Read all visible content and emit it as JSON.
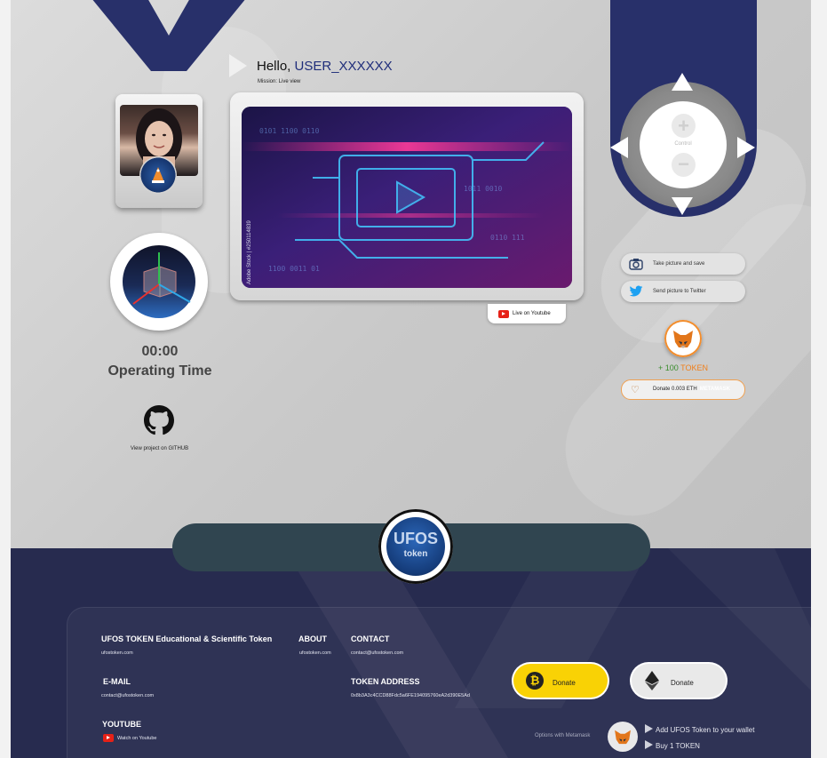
{
  "header": {
    "greeting": "Hello,",
    "username": "USER_XXXXXX",
    "mission": "Mission: Live view"
  },
  "left": {
    "timer_value": "00:00",
    "timer_label": "Operating Time",
    "github_label": "View project on GITHUB"
  },
  "monitor": {
    "watermark": "Adobe Stock | #250114839",
    "live_button": "Live on Youtube"
  },
  "controls": {
    "center_label": "Control",
    "plus": "+",
    "minus": "−",
    "picture_button": "Take picture and save",
    "twitter_button": "Send picture to Twitter"
  },
  "reward": {
    "plus": "+",
    "amount": "100",
    "unit": "TOKEN",
    "donate_text": "Donate 0.003 ETH",
    "donate_brand": "METAMASK"
  },
  "footer": {
    "logo_top": "UFOS",
    "logo_bottom": "token",
    "title": "UFOS TOKEN Educational & Scientific Token",
    "site": "ufostoken.com",
    "about_heading": "ABOUT",
    "about_link": "ufostoken.com",
    "contact_heading": "CONTACT",
    "contact_email": "contact@ufostoken.com",
    "email_heading": "E-MAIL",
    "email_value": "contact@ufostoken.com",
    "token_heading": "TOKEN ADDRESS",
    "token_address": "0x8b3A3c4CCD88Fdc5a6FE194095760eA2d390E5Ad",
    "youtube_heading": "YOUTUBE",
    "youtube_link": "Watch on Youtube",
    "btc_donate": "Donate",
    "eth_donate": "Donate",
    "options_label": "Options with Metamask",
    "add_token": "Add UFOS Token to your wallet",
    "buy_token": "Buy 1 TOKEN"
  },
  "colors": {
    "navy": "#28306a",
    "footer_bg": "#272b4f",
    "bitcoin_yellow": "#f9d205",
    "metamask_orange": "#f28d2d",
    "username_blue": "#1f2d7a"
  },
  "icons": [
    "play-icon",
    "github-icon",
    "youtube-icon",
    "camera-icon",
    "twitter-icon",
    "metamask-fox-icon",
    "heart-icon",
    "bitcoin-icon",
    "ethereum-icon",
    "arrow-up-icon",
    "arrow-down-icon",
    "arrow-left-icon",
    "arrow-right-icon"
  ]
}
